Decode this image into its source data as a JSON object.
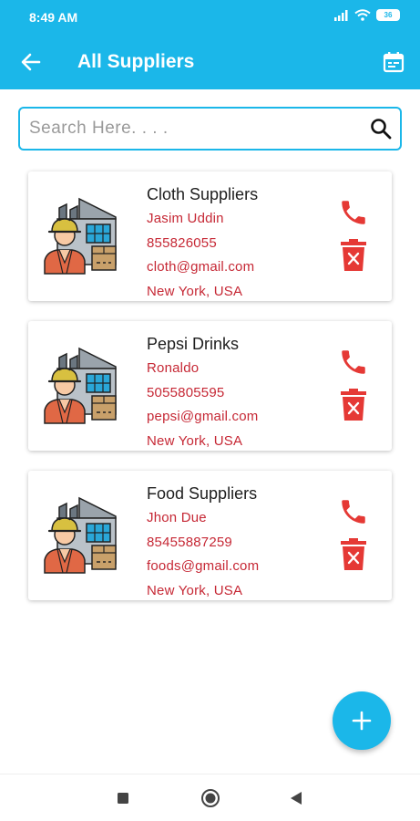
{
  "status_bar": {
    "time": "8:49 AM",
    "battery": "36"
  },
  "app_bar": {
    "title": "All Suppliers"
  },
  "search": {
    "placeholder": "Search Here. . . ."
  },
  "suppliers": [
    {
      "name": "Cloth Suppliers",
      "contact": "Jasim Uddin",
      "phone": "855826055",
      "email": "cloth@gmail.com",
      "address": "New York, USA"
    },
    {
      "name": "Pepsi Drinks",
      "contact": "Ronaldo",
      "phone": "5055805595",
      "email": "pepsi@gmail.com",
      "address": "New York, USA"
    },
    {
      "name": "Food Suppliers",
      "contact": "Jhon Due",
      "phone": "85455887259",
      "email": "foods@gmail.com",
      "address": "New York, USA"
    }
  ],
  "icons": {
    "back": "arrow-left-icon",
    "calendar": "calendar-icon",
    "search": "search-icon",
    "call": "phone-icon",
    "delete": "trash-icon",
    "add": "plus-icon",
    "supplier": "factory-worker-icon"
  },
  "colors": {
    "primary": "#1bb7e9",
    "accent_red": "#e53935",
    "detail_text": "#c62835"
  }
}
